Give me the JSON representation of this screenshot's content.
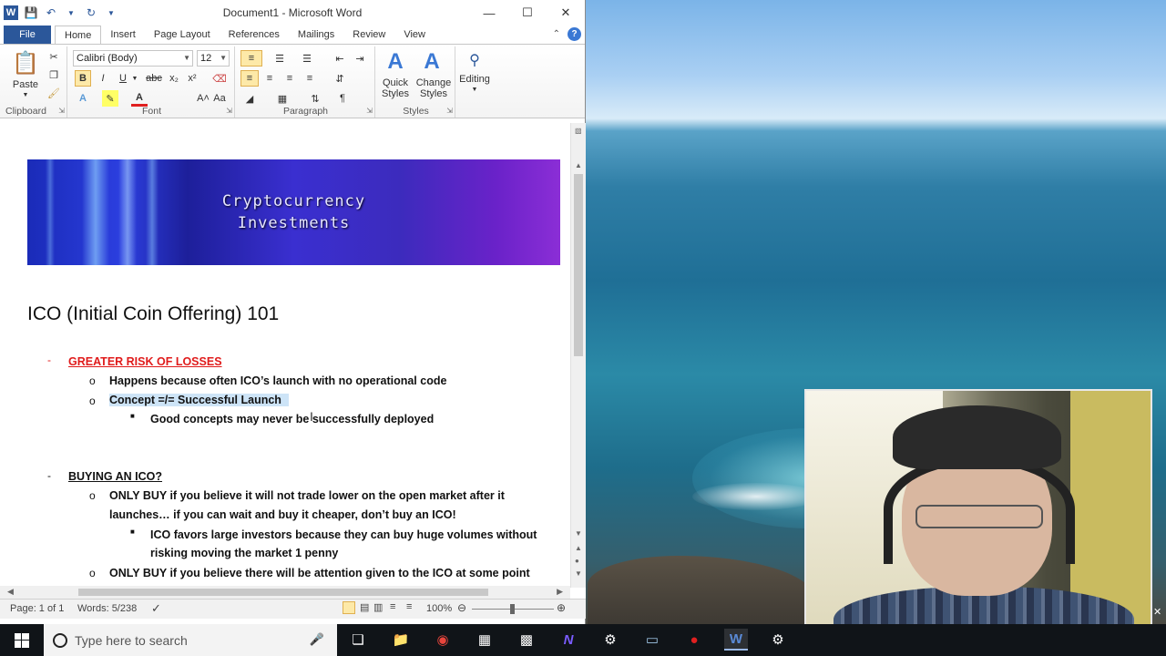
{
  "window": {
    "title": "Document1 - Microsoft Word"
  },
  "tabs": [
    "File",
    "Home",
    "Insert",
    "Page Layout",
    "References",
    "Mailings",
    "Review",
    "View"
  ],
  "ribbon": {
    "clipboard": {
      "label": "Clipboard",
      "paste": "Paste"
    },
    "font": {
      "label": "Font",
      "name": "Calibri (Body)",
      "size": "12"
    },
    "paragraph": {
      "label": "Paragraph"
    },
    "styles": {
      "label": "Styles",
      "quick": "Quick\nStyles",
      "change": "Change\nStyles"
    },
    "editing": {
      "label": "Editing"
    }
  },
  "document": {
    "banner_line1": "Cryptocurrency",
    "banner_line2": "Investments",
    "title": "ICO (Initial Coin Offering) 101",
    "sections": [
      {
        "heading": "GREATER RISK OF LOSSES",
        "items": [
          "Happens because often ICO’s launch with no operational code",
          "Concept =/= Successful Launch"
        ],
        "subitem": "Good concepts may never be successfully deployed"
      },
      {
        "heading": "BUYING AN ICO?",
        "item1_line1": "ONLY BUY if you believe it will not trade lower on the open market after it",
        "item1_line2": "launches… if you can wait and buy it cheaper, don’t buy an ICO!",
        "subitem_line1": "ICO favors large investors because they can buy huge volumes without",
        "subitem_line2": "risking moving the market 1 penny",
        "item2": "ONLY BUY if you believe there will be attention given to the ICO at some point"
      }
    ]
  },
  "status": {
    "page": "Page: 1 of 1",
    "words": "Words: 5/238",
    "zoom": "100%"
  },
  "taskbar": {
    "search_placeholder": "Type here to search"
  }
}
